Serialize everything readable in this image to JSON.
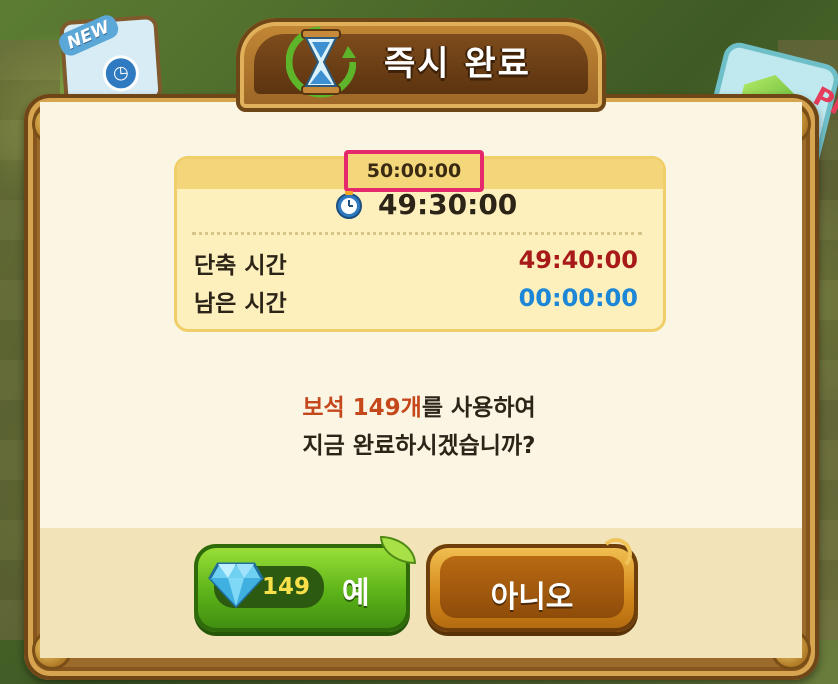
{
  "dialog": {
    "title": "즉시 완료",
    "original_time": "50:00:00",
    "current_time": "49:30:00",
    "rows": [
      {
        "label": "단축 시간",
        "value": "49:40:00",
        "color": "#a81a1a"
      },
      {
        "label": "남은 시간",
        "value": "00:00:00",
        "color": "#1d86d6"
      }
    ],
    "message": {
      "highlight": "보석 149개",
      "line1_rest": "를 사용하여",
      "line2": "지금 완료하시겠습니까?"
    },
    "buttons": {
      "yes": {
        "gem_count": "149",
        "label": "예"
      },
      "no": {
        "label": "아니오"
      }
    }
  },
  "badges": {
    "new": "NEW",
    "gem_badge_label": "PI"
  },
  "icons": {
    "title": "hourglass-icon",
    "timer": "clock-icon",
    "yes_button": "diamond-icon"
  },
  "colors": {
    "frame": "#9c6a2a",
    "yes_button": "#5cb319",
    "no_button": "#d68a1c",
    "highlight": "#e4296d",
    "message_highlight": "#c5481c"
  }
}
